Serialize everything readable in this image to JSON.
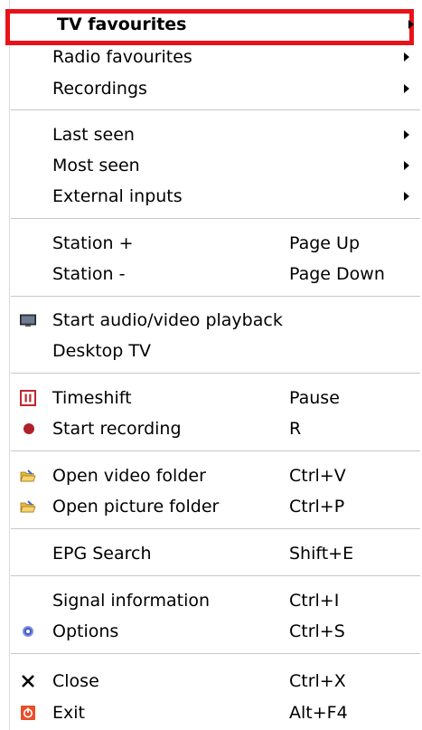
{
  "menu": {
    "tv_favourites": "TV favourites",
    "radio_favourites": "Radio favourites",
    "recordings": "Recordings",
    "last_seen": "Last seen",
    "most_seen": "Most seen",
    "external_inputs": "External inputs",
    "station_up": "Station +",
    "station_up_shortcut": "Page Up",
    "station_down": "Station -",
    "station_down_shortcut": "Page Down",
    "start_playback": "Start audio/video playback",
    "desktop_tv": "Desktop TV",
    "timeshift": "Timeshift",
    "timeshift_shortcut": "Pause",
    "start_recording": "Start recording",
    "start_recording_shortcut": "R",
    "open_video_folder": "Open video folder",
    "open_video_folder_shortcut": "Ctrl+V",
    "open_picture_folder": "Open picture folder",
    "open_picture_folder_shortcut": "Ctrl+P",
    "epg_search": "EPG Search",
    "epg_search_shortcut": "Shift+E",
    "signal_information": "Signal information",
    "signal_information_shortcut": "Ctrl+I",
    "options": "Options",
    "options_shortcut": "Ctrl+S",
    "close": "Close",
    "close_shortcut": "Ctrl+X",
    "exit": "Exit",
    "exit_shortcut": "Alt+F4"
  },
  "colors": {
    "highlight_border": "#e8121a",
    "record_dot": "#b0202a",
    "timeshift_icon": "#c0282e",
    "exit_icon": "#e8502a"
  },
  "icons": [
    "monitor-icon",
    "pause-icon",
    "record-dot-icon",
    "folder-open-icon",
    "options-gear-icon",
    "close-x-icon",
    "power-exit-icon"
  ]
}
